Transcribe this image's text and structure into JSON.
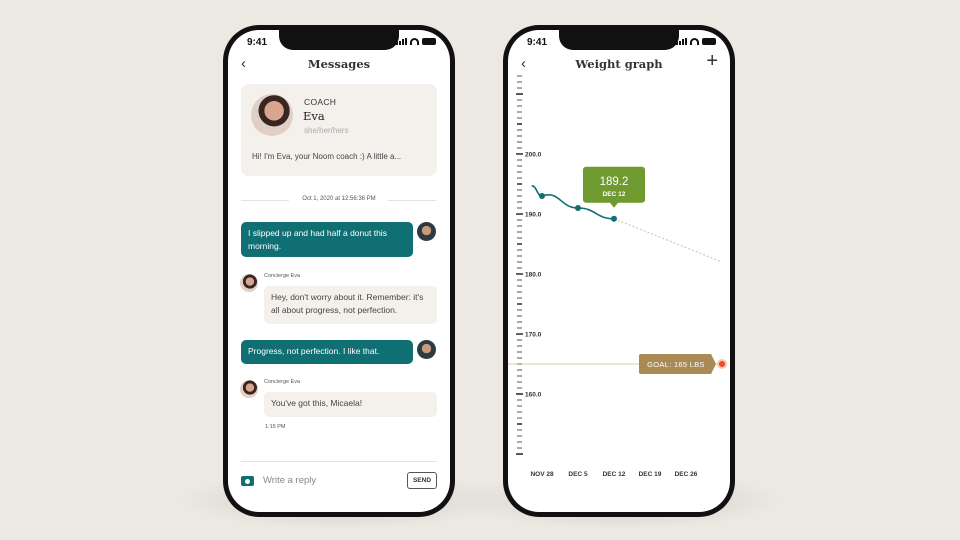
{
  "messages_screen": {
    "status_time": "9:41",
    "title": "Messages",
    "coach_card": {
      "role": "COACH",
      "name": "Eva",
      "pronouns": "she/her/hers",
      "preview": "Hi! I'm Eva, your Noom coach :) A little a..."
    },
    "timestamp": "Oct 1, 2020 at 12:56:36 PM",
    "messages": [
      {
        "from": "me",
        "text": "I slipped up and had half a donut this morning."
      },
      {
        "from": "coach",
        "sender": "Concierge Eva",
        "text": "Hey, don't worry about it. Remember: it's all about progress, not perfection."
      },
      {
        "from": "me",
        "text": "Progress, not perfection. I like that."
      },
      {
        "from": "coach",
        "sender": "Concierge Eva",
        "text": "You've got this, Micaela!"
      }
    ],
    "last_time": "1:15 PM",
    "composer": {
      "placeholder": "Write a reply",
      "send_label": "SEND"
    },
    "colors": {
      "accent": "#0f6f73",
      "bubble": "#f4f1ec"
    }
  },
  "weight_screen": {
    "status_time": "9:41",
    "title": "Weight graph",
    "chart_data": {
      "type": "line",
      "y_tick_labels": [
        "200.0",
        "190.0",
        "180.0",
        "170.0",
        "160.0"
      ],
      "x_tick_labels": [
        "NOV 28",
        "DEC 5",
        "DEC 12",
        "DEC 19",
        "DEC 26"
      ],
      "ylim": [
        157,
        209
      ],
      "series": [
        {
          "x": [
            "NOV 26",
            "NOV 28",
            "DEC 5",
            "DEC 12"
          ],
          "values": [
            194.7,
            193.0,
            191.0,
            189.2
          ]
        }
      ],
      "projection": {
        "from": [
          "DEC 12",
          189.2
        ],
        "to": [
          "JAN 2",
          182.0
        ]
      },
      "tooltip": {
        "value": "189.2",
        "date": "DEC 12"
      },
      "goal": {
        "value": 165,
        "label": "GOAL: 165 LBS"
      },
      "colors": {
        "line": "#0f6f73",
        "tooltip": "#6e9a2f",
        "goal": "#a98a55",
        "goal_dot": "#ee4c2c",
        "projection": "#d8c9a8"
      }
    }
  }
}
